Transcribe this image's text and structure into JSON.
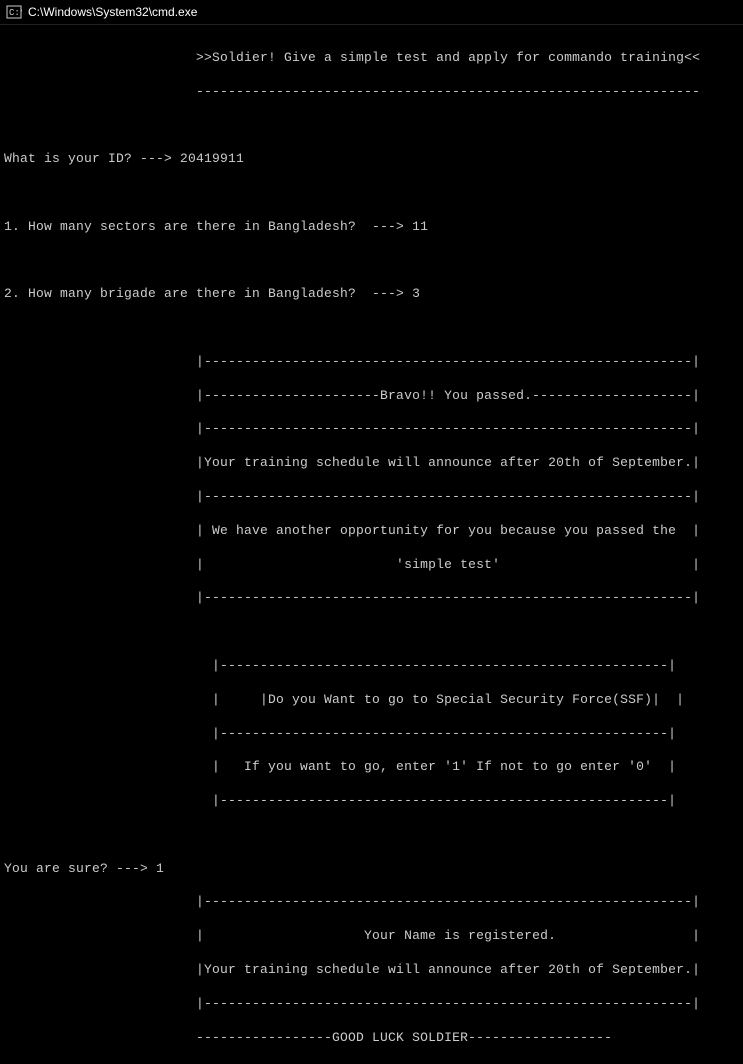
{
  "window": {
    "title": "C:\\Windows\\System32\\cmd.exe"
  },
  "lines": {
    "banner1": "                        >>Soldier! Give a simple test and apply for commando training<<",
    "banner2": "                        ---------------------------------------------------------------",
    "idPrompt": "What is your ID? ---> 20419911",
    "q1": "1. How many sectors are there in Bangladesh?  ---> 11",
    "q2": "2. How many brigade are there in Bangladesh?  ---> 3",
    "box1a": "                        |-------------------------------------------------------------|",
    "box1b": "                        |----------------------Bravo!! You passed.--------------------|",
    "box1c": "                        |-------------------------------------------------------------|",
    "box1d": "                        |Your training schedule will announce after 20th of September.|",
    "box1e": "                        |-------------------------------------------------------------|",
    "box1f": "                        | We have another opportunity for you because you passed the  |",
    "box1g": "                        |                        'simple test'                        |",
    "box1h": "                        |-------------------------------------------------------------|",
    "box2a": "                          |--------------------------------------------------------|",
    "box2b": "                          |     |Do you Want to go to Special Security Force(SSF)|  |",
    "box2c": "                          |--------------------------------------------------------|",
    "box2d": "                          |   If you want to go, enter '1' If not to go enter '0'  |",
    "box2e": "                          |--------------------------------------------------------|",
    "surePrompt": "You are sure? ---> 1",
    "box3a": "                        |-------------------------------------------------------------|",
    "box3b": "                        |                    Your Name is registered.                 |",
    "box3c": "                        |Your training schedule will announce after 20th of September.|",
    "box3d": "                        |-------------------------------------------------------------|",
    "footer": "                        -----------------GOOD LUCK SOLDIER------------------"
  }
}
